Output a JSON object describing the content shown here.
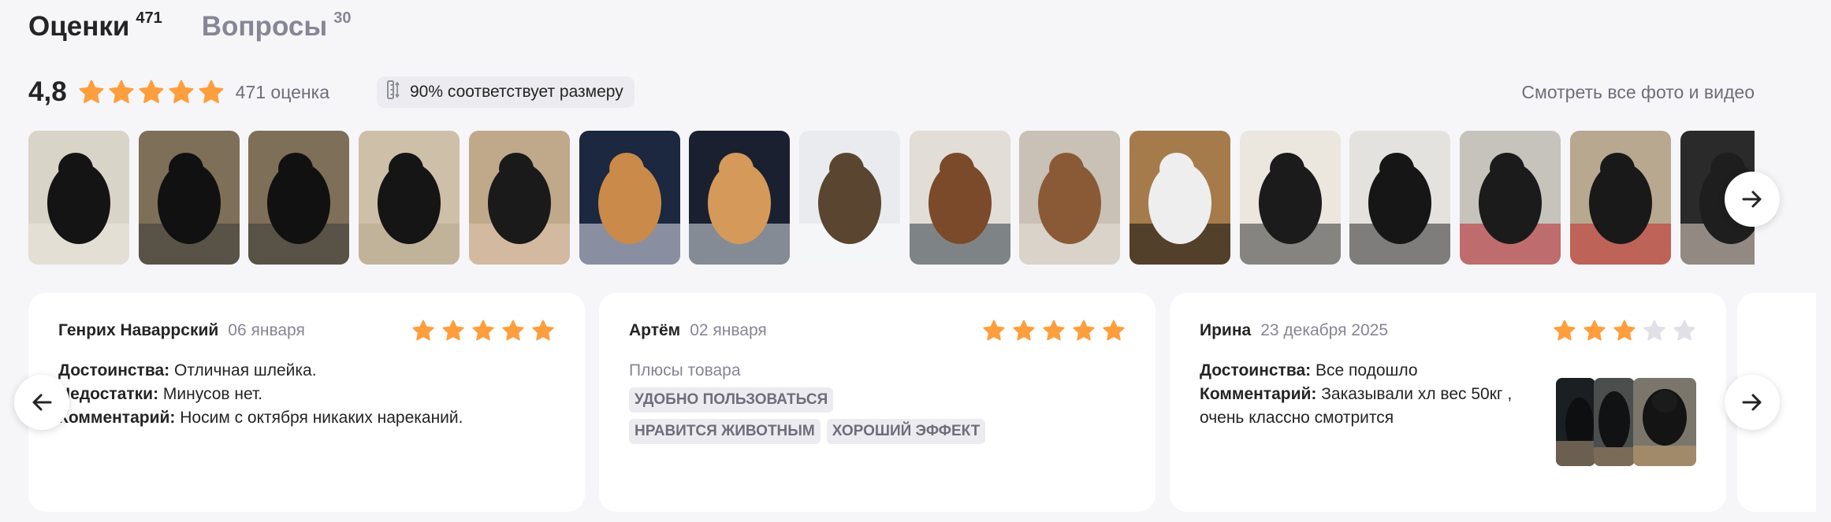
{
  "tabs": [
    {
      "label": "Оценки",
      "count": "471"
    },
    {
      "label": "Вопросы",
      "count": "30"
    }
  ],
  "summary": {
    "rating": "4,8",
    "stars_filled": 5,
    "reviews_count": "471 оценка",
    "fit_badge": "90% соответствует размеру",
    "view_all": "Смотреть все фото и видео"
  },
  "gallery": {
    "thumbs": [
      {
        "icon": "photo-black-dog-sitting"
      },
      {
        "icon": "photo-black-dog-harness"
      },
      {
        "icon": "photo-black-dog-harness"
      },
      {
        "icon": "photo-black-dog-side"
      },
      {
        "icon": "photo-black-dog-blurry"
      },
      {
        "icon": "photo-shiba-snow-night"
      },
      {
        "icon": "photo-shiba-harness-night"
      },
      {
        "icon": "photo-dog-snow"
      },
      {
        "icon": "photo-staffy-harness"
      },
      {
        "icon": "photo-staffy-living-room"
      },
      {
        "icon": "photo-white-dog-harness"
      },
      {
        "icon": "photo-harness-product"
      },
      {
        "icon": "photo-harness-product-back"
      },
      {
        "icon": "photo-harness-in-hand"
      },
      {
        "icon": "photo-harness-red-black"
      },
      {
        "icon": "photo-harness-partial"
      }
    ]
  },
  "reviews": [
    {
      "author": "Генрих Наваррский",
      "date": "06 января",
      "stars": 5,
      "pros_label": "Достоинства:",
      "pros": "Отличная шлейка.",
      "cons_label": "Недостатки:",
      "cons": "Минусов нет.",
      "comment_label": "Комментарий:",
      "comment": "Носим с октября никаких нареканий."
    },
    {
      "author": "Артём",
      "date": "02 января",
      "stars": 5,
      "pros_title": "Плюсы товара",
      "tags": [
        "УДОБНО ПОЛЬЗОВАТЬСЯ",
        "НРАВИТСЯ ЖИВОТНЫМ",
        "ХОРОШИЙ ЭФФЕКТ"
      ]
    },
    {
      "author": "Ирина",
      "date": "23 декабря 2025",
      "stars": 3,
      "pros_label": "Достоинства:",
      "pros": "Все подошло",
      "comment_label": "Комментарий:",
      "comment": "Заказывали хл вес 50кг ,",
      "comment_line2": "очень классно смотрится"
    }
  ],
  "colors": {
    "star": "#ff9e3d",
    "star_empty": "#e0e0e6",
    "accent_text": "#242424",
    "muted_text": "#868695"
  }
}
